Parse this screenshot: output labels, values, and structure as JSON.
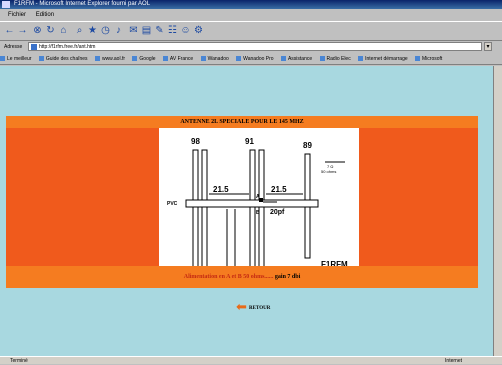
{
  "window": {
    "title": "F1RFM - Microsoft Internet Explorer fourni par AOL"
  },
  "menu": {
    "items": [
      "Fichier",
      "Edition"
    ]
  },
  "address": {
    "label": "Adresse",
    "url": "http://f1rfm.free.fr/ant.htm"
  },
  "links": {
    "items": [
      "Le meilleur",
      "Guide des chaînes",
      "www.aol.fr",
      "Google",
      "AV France",
      "Wanadoo",
      "Wanadoo Pro",
      "Assistance",
      "Radio Elec",
      "Internet démarrage",
      "Microsoft"
    ]
  },
  "page": {
    "title": "ANTENNE 2L SPECIALE POUR LE 145 MHZ",
    "feed_text": "Alimentation en A et B 50 ohms......",
    "gain_text": "gain 7 dbi",
    "back_label": "RETOUR"
  },
  "diagram": {
    "len_1": "98",
    "len_2": "91",
    "len_3": "89",
    "dim_1": "21.5",
    "dim_2": "21.5",
    "pvc": "PVC",
    "cap": "20pf",
    "point_a": "A",
    "point_b": "B",
    "impedance": "7 Ω",
    "impedance_2": "50 ohms",
    "callsign": "F1RFM"
  },
  "status": {
    "left": "Terminé",
    "zone": "Internet"
  }
}
